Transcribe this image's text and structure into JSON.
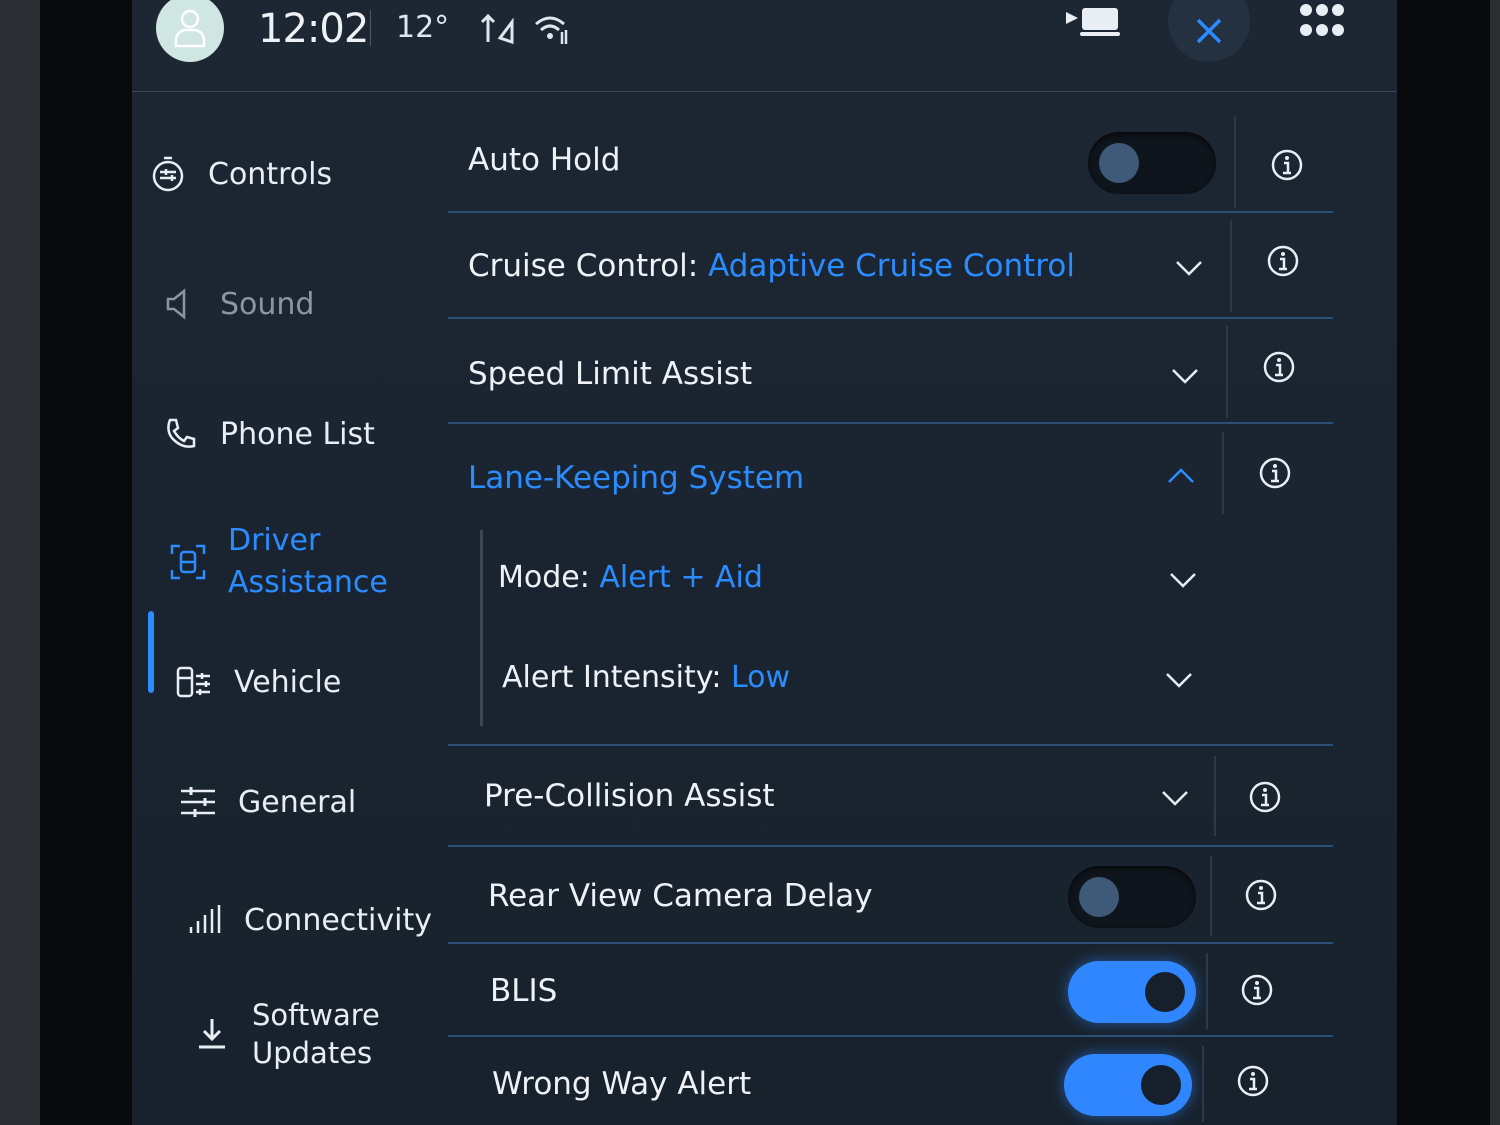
{
  "status": {
    "time": "12:02",
    "temperature": "12°",
    "icons": [
      "user-avatar-icon",
      "data-transfer-icon",
      "wifi-icon",
      "camera-icon",
      "close-icon",
      "apps-grid-icon"
    ]
  },
  "sidebar": {
    "items": [
      {
        "label": "Controls",
        "icon": "controls-icon",
        "state": "normal"
      },
      {
        "label": "Sound",
        "icon": "speaker-icon",
        "state": "dim"
      },
      {
        "label": "Phone List",
        "icon": "phone-icon",
        "state": "normal"
      },
      {
        "label": "Driver",
        "label2": "Assistance",
        "icon": "driver-assist-icon",
        "state": "active"
      },
      {
        "label": "Vehicle",
        "icon": "vehicle-icon",
        "state": "normal"
      },
      {
        "label": "General",
        "icon": "sliders-icon",
        "state": "normal"
      },
      {
        "label": "Connectivity",
        "icon": "signal-icon",
        "state": "normal"
      },
      {
        "label": "Software",
        "label2": "Updates",
        "icon": "download-icon",
        "state": "normal"
      }
    ]
  },
  "settings": {
    "auto_hold": {
      "label": "Auto Hold",
      "on": false
    },
    "cruise": {
      "label": "Cruise Control:",
      "value": "Adaptive Cruise Control"
    },
    "speed_limit": {
      "label": "Speed Limit Assist"
    },
    "lane_keeping": {
      "label": "Lane-Keeping System",
      "expanded": true
    },
    "lk_mode": {
      "label": "Mode:",
      "value": "Alert + Aid"
    },
    "lk_intensity": {
      "label": "Alert Intensity:",
      "value": "Low"
    },
    "pre_collision": {
      "label": "Pre-Collision Assist"
    },
    "rear_camera": {
      "label": "Rear View Camera Delay",
      "on": false
    },
    "blis": {
      "label": "BLIS",
      "on": true
    },
    "wrong_way": {
      "label": "Wrong Way Alert",
      "on": true
    }
  },
  "colors": {
    "accent": "#2b8cff",
    "background": "#1b2531",
    "divider": "#2c4f76",
    "text": "#eef2f6"
  }
}
